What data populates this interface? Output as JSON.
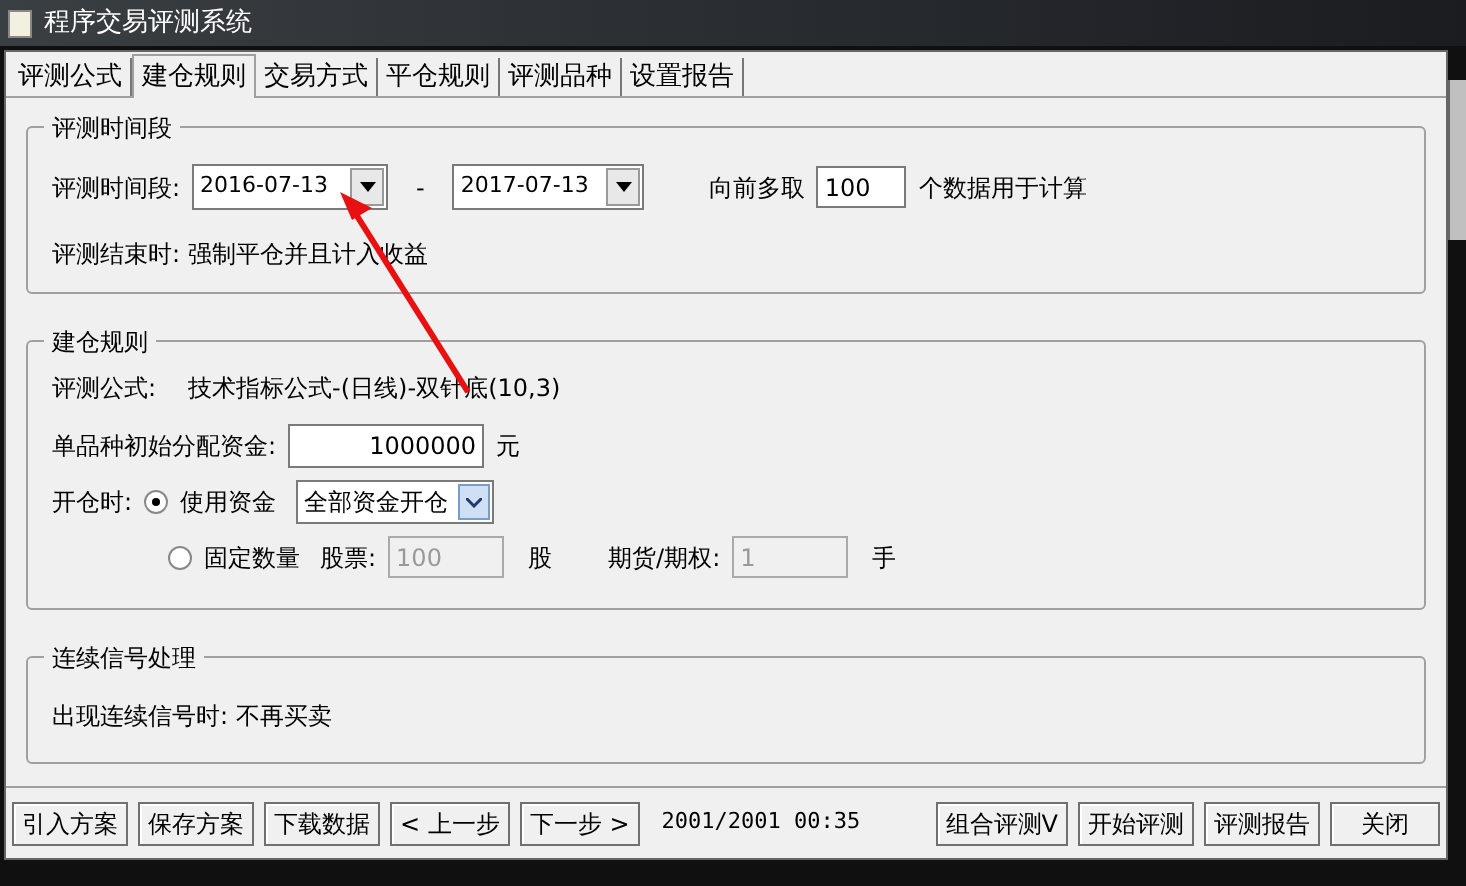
{
  "window": {
    "title": "程序交易评测系统"
  },
  "tabs": [
    {
      "label": "评测公式",
      "selected": false
    },
    {
      "label": "建仓规则",
      "selected": true
    },
    {
      "label": "交易方式",
      "selected": false
    },
    {
      "label": "平仓规则",
      "selected": false
    },
    {
      "label": "评测品种",
      "selected": false
    },
    {
      "label": "设置报告",
      "selected": false
    }
  ],
  "period_group": {
    "title": "评测时间段",
    "label": "评测时间段:",
    "start_date": "2016-07-13",
    "separator": "-",
    "end_date": "2017-07-13",
    "prefetch_label": "向前多取",
    "prefetch_value": "100",
    "prefetch_suffix": "个数据用于计算",
    "end_label": "评测结束时:",
    "end_text": "强制平仓并且计入收益"
  },
  "build_group": {
    "title": "建仓规则",
    "formula_label": "评测公式:",
    "formula": "技术指标公式-(日线)-双针底(10,3)",
    "capital_label": "单品种初始分配资金:",
    "capital_value": "1000000",
    "capital_unit": "元",
    "open_label": "开仓时:",
    "options": [
      {
        "label": "使用资金",
        "selected": true
      },
      {
        "label": "固定数量",
        "selected": false
      }
    ],
    "capital_mode": "全部资金开仓",
    "stock_label": "股票:",
    "stock_value": "100",
    "stock_unit": "股",
    "futures_label": "期货/期权:",
    "futures_value": "1",
    "futures_unit": "手"
  },
  "signal_group": {
    "title": "连续信号处理",
    "text": "出现连续信号时: 不再买卖"
  },
  "buttons_left": [
    "引入方案",
    "保存方案",
    "下载数据",
    "< 上一步",
    "下一步 >"
  ],
  "status": "2001/2001 00:35",
  "buttons_right": [
    "组合评测V",
    "开始评测",
    "评测报告",
    "关闭"
  ]
}
